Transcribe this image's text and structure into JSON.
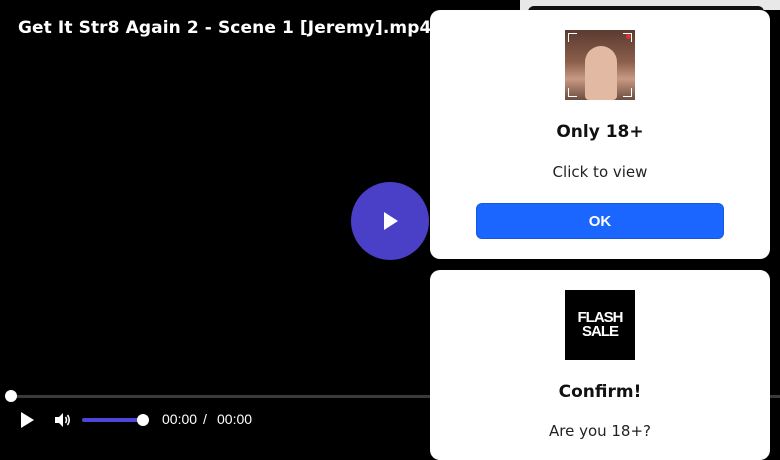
{
  "player": {
    "title": "Get It Str8 Again 2 - Scene 1 [Jeremy].mp4",
    "current_time": "00:00",
    "time_separator": "/",
    "duration": "00:00",
    "progress": 0,
    "volume": 1.0,
    "accent_color": "#4a3fc7"
  },
  "popups": [
    {
      "thumbnail_icon": "camera-feed-thumbnail",
      "title": "Only 18+",
      "text": "Click to view",
      "button_label": "OK",
      "button_color": "#1a66ff"
    },
    {
      "thumbnail_line1": "FLASH",
      "thumbnail_line2": "SALE",
      "title": "Confirm!",
      "text": "Are you 18+?"
    }
  ]
}
